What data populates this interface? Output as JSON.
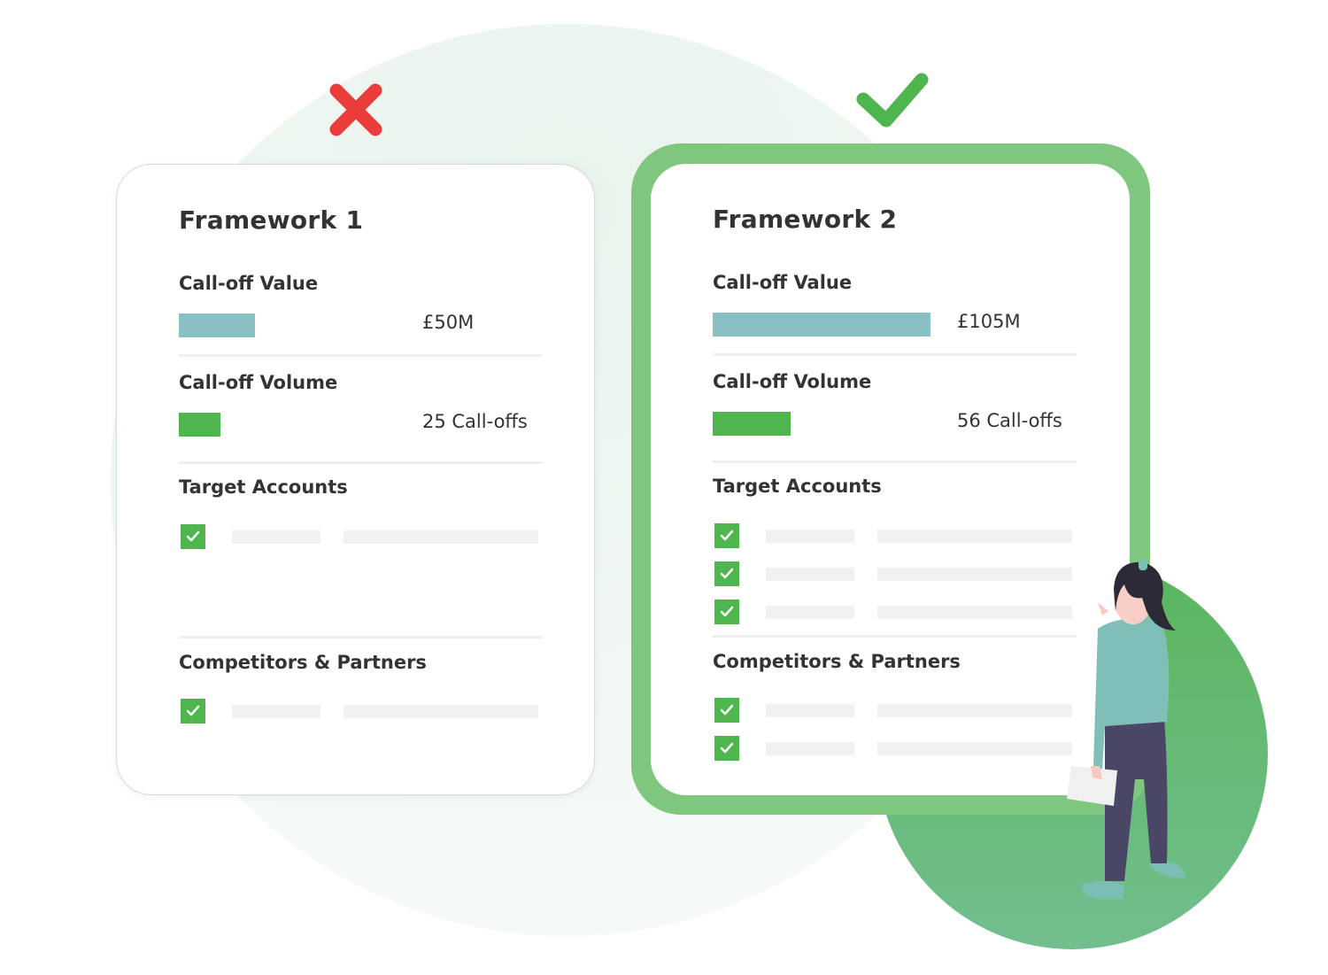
{
  "colors": {
    "value_bar": "#88c0c4",
    "volume_bar": "#4fb64f",
    "check": "#4fb64f",
    "reject": "#ec3b3b",
    "accept": "#4fb64f",
    "frame": "#7fc67f"
  },
  "icons": {
    "rejected": "x-mark-icon",
    "selected": "checkmark-icon",
    "row": "checkbox-checked-icon"
  },
  "cards": [
    {
      "title": "Framework 1",
      "status": "rejected",
      "value_label": "Call-off Value",
      "value_text": "£50M",
      "value_fill": 0.21,
      "volume_label": "Call-off Volume",
      "volume_text": "25 Call-offs",
      "volume_fill": 0.115,
      "targets_label": "Target Accounts",
      "targets_count": 1,
      "competitors_label": "Competitors & Partners",
      "competitors_count": 1
    },
    {
      "title": "Framework 2",
      "status": "selected",
      "value_label": "Call-off Value",
      "value_text": "£105M",
      "value_fill": 0.6,
      "volume_label": "Call-off Volume",
      "volume_text": "56 Call-offs",
      "volume_fill": 0.215,
      "targets_label": "Target Accounts",
      "targets_count": 3,
      "competitors_label": "Competitors & Partners",
      "competitors_count": 2
    }
  ]
}
